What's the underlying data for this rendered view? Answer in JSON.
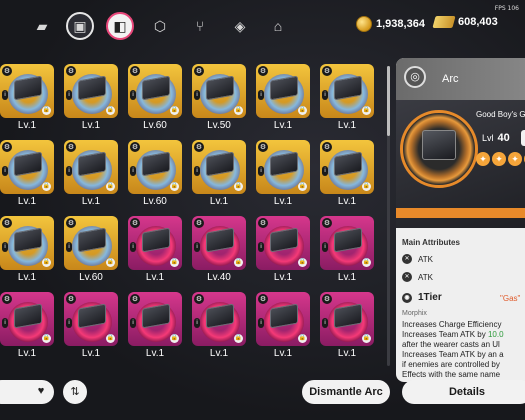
{
  "top": {
    "fps_label": "FPS 106",
    "gold": "1,938,364",
    "tickets": "608,403",
    "nav": [
      {
        "icon": "grid-icon"
      },
      {
        "icon": "gamepad-icon"
      },
      {
        "icon": "arc-icon"
      },
      {
        "icon": "cube-icon"
      },
      {
        "icon": "utensils-icon"
      },
      {
        "icon": "dismantle-icon"
      },
      {
        "icon": "home-icon"
      }
    ]
  },
  "grid": {
    "cards": [
      {
        "level": "Lv.1",
        "tier": "gold",
        "locked": true
      },
      {
        "level": "Lv.1",
        "tier": "gold",
        "locked": true
      },
      {
        "level": "Lv.60",
        "tier": "gold",
        "locked": true
      },
      {
        "level": "Lv.50",
        "tier": "gold",
        "locked": true
      },
      {
        "level": "Lv.1",
        "tier": "gold",
        "locked": true
      },
      {
        "level": "Lv.1",
        "tier": "gold",
        "locked": true
      },
      {
        "level": "Lv.1",
        "tier": "gold",
        "locked": true
      },
      {
        "level": "Lv.1",
        "tier": "gold",
        "locked": true
      },
      {
        "level": "Lv.60",
        "tier": "gold",
        "locked": true
      },
      {
        "level": "Lv.1",
        "tier": "gold",
        "locked": true
      },
      {
        "level": "Lv.1",
        "tier": "gold",
        "locked": true
      },
      {
        "level": "Lv.1",
        "tier": "gold",
        "locked": true
      },
      {
        "level": "Lv.1",
        "tier": "gold",
        "locked": true
      },
      {
        "level": "Lv.60",
        "tier": "gold",
        "locked": true
      },
      {
        "level": "Lv.1",
        "tier": "pink",
        "locked": true
      },
      {
        "level": "Lv.40",
        "tier": "pink",
        "locked": true
      },
      {
        "level": "Lv.1",
        "tier": "pink",
        "locked": true
      },
      {
        "level": "Lv.1",
        "tier": "pink",
        "locked": true
      },
      {
        "level": "Lv.1",
        "tier": "pink",
        "locked": true
      },
      {
        "level": "Lv.1",
        "tier": "pink",
        "locked": true
      },
      {
        "level": "Lv.1",
        "tier": "pink",
        "locked": true
      },
      {
        "level": "Lv.1",
        "tier": "pink",
        "locked": true
      },
      {
        "level": "Lv.1",
        "tier": "pink",
        "locked": true
      },
      {
        "level": "Lv.1",
        "tier": "pink",
        "locked": true
      }
    ]
  },
  "panel": {
    "header_title": "Arc",
    "item_name": "Good Boy's Gr",
    "level_label": "Lvl",
    "level_value": "40",
    "main_attributes_label": "Main Attributes",
    "attributes": [
      "ATK",
      "ATK"
    ],
    "tier_label": "1Tier",
    "tier_tag": "\"Gas\"",
    "desc_title": "Morphix",
    "desc_lines": [
      {
        "text": "Increases Charge Efficiency"
      },
      {
        "text": "Increases Team ATK by ",
        "highlight": "10.0"
      },
      {
        "text": "after the wearer casts an Ul"
      },
      {
        "text": "Increases Team ATK by an a"
      },
      {
        "text": "if enemies are controlled by"
      },
      {
        "text": "Effects with the same name"
      }
    ]
  },
  "bottom": {
    "dismantle_label": "Dismantle Arc",
    "details_label": "Details"
  },
  "colors": {
    "gold_card": "#f3c53d",
    "pink_card": "#d6378c",
    "accent_orange": "#e88a2a"
  }
}
